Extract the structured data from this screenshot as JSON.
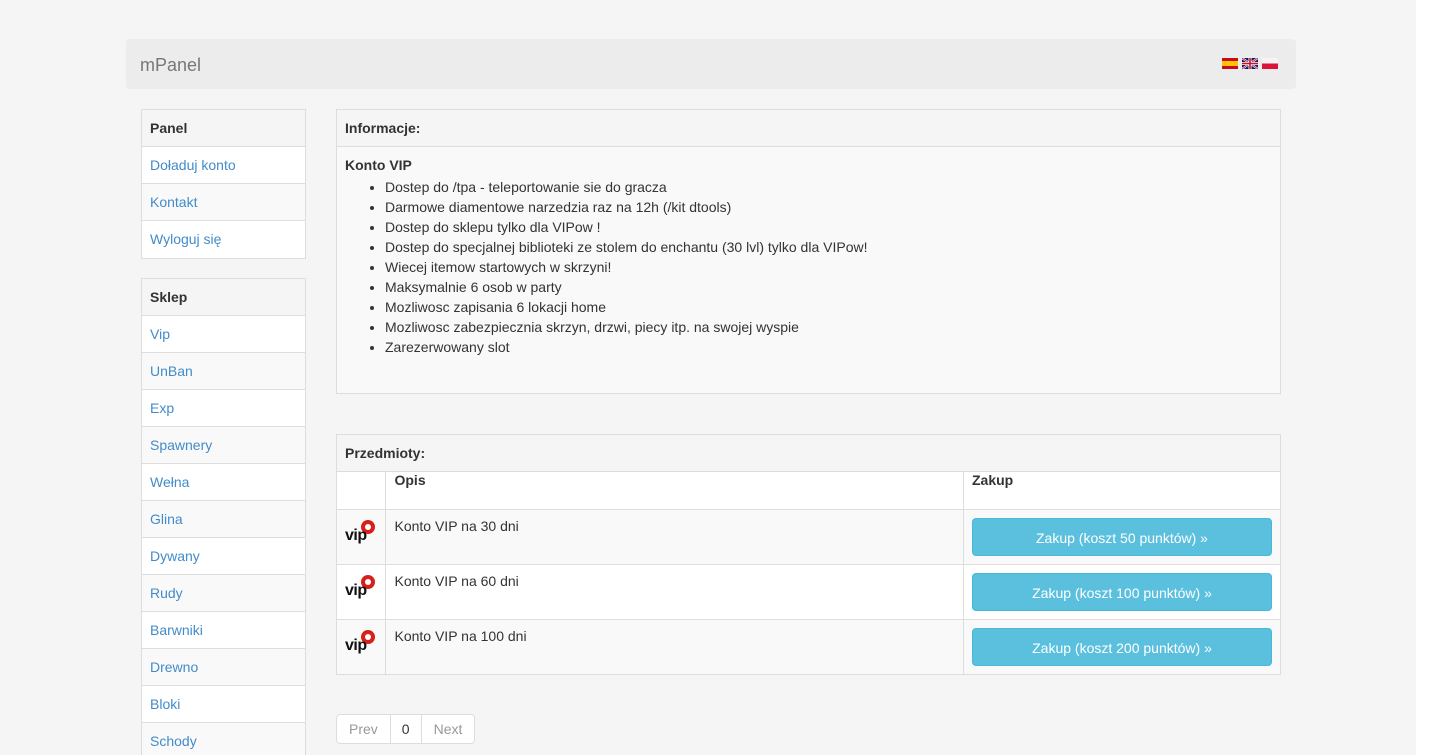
{
  "navbar": {
    "brand": "mPanel",
    "languages": [
      "es-flag",
      "uk-flag",
      "pl-flag"
    ]
  },
  "sidebar": {
    "panel": {
      "title": "Panel",
      "items": [
        "Doładuj konto",
        "Kontakt",
        "Wyloguj się"
      ]
    },
    "shop": {
      "title": "Sklep",
      "items": [
        "Vip",
        "UnBan",
        "Exp",
        "Spawnery",
        "Wełna",
        "Glina",
        "Dywany",
        "Rudy",
        "Barwniki",
        "Drewno",
        "Bloki",
        "Schody"
      ]
    }
  },
  "info": {
    "heading": "Informacje:",
    "title": "Konto VIP",
    "features": [
      "Dostep do /tpa - teleportowanie sie do gracza",
      "Darmowe diamentowe narzedzia raz na 12h (/kit dtools)",
      "Dostep do sklepu tylko dla VIPow !",
      "Dostep do specjalnej biblioteki ze stolem do enchantu (30 lvl) tylko dla VIPow!",
      "Wiecej itemow startowych w skrzyni!",
      "Maksymalnie 6 osob w party",
      "Mozliwosc zapisania 6 lokacji home",
      "Mozliwosc zabezpiecznia skrzyn, drzwi, piecy itp. na swojej wyspie",
      "Zarezerwowany slot"
    ]
  },
  "items": {
    "heading": "Przedmioty:",
    "columns": [
      "",
      "Opis",
      "Zakup"
    ],
    "logo_text": "vip",
    "rows": [
      {
        "desc": "Konto VIP na 30 dni",
        "button": "Zakup (koszt 50 punktów) »"
      },
      {
        "desc": "Konto VIP na 60 dni",
        "button": "Zakup (koszt 100 punktów) »"
      },
      {
        "desc": "Konto VIP na 100 dni",
        "button": "Zakup (koszt 200 punktów) »"
      }
    ]
  },
  "pager": {
    "prev": "Prev",
    "current": "0",
    "next": "Next"
  },
  "colors": {
    "accent": "#5bc0de",
    "link": "#428bca",
    "logo_red": "#d6201b"
  }
}
